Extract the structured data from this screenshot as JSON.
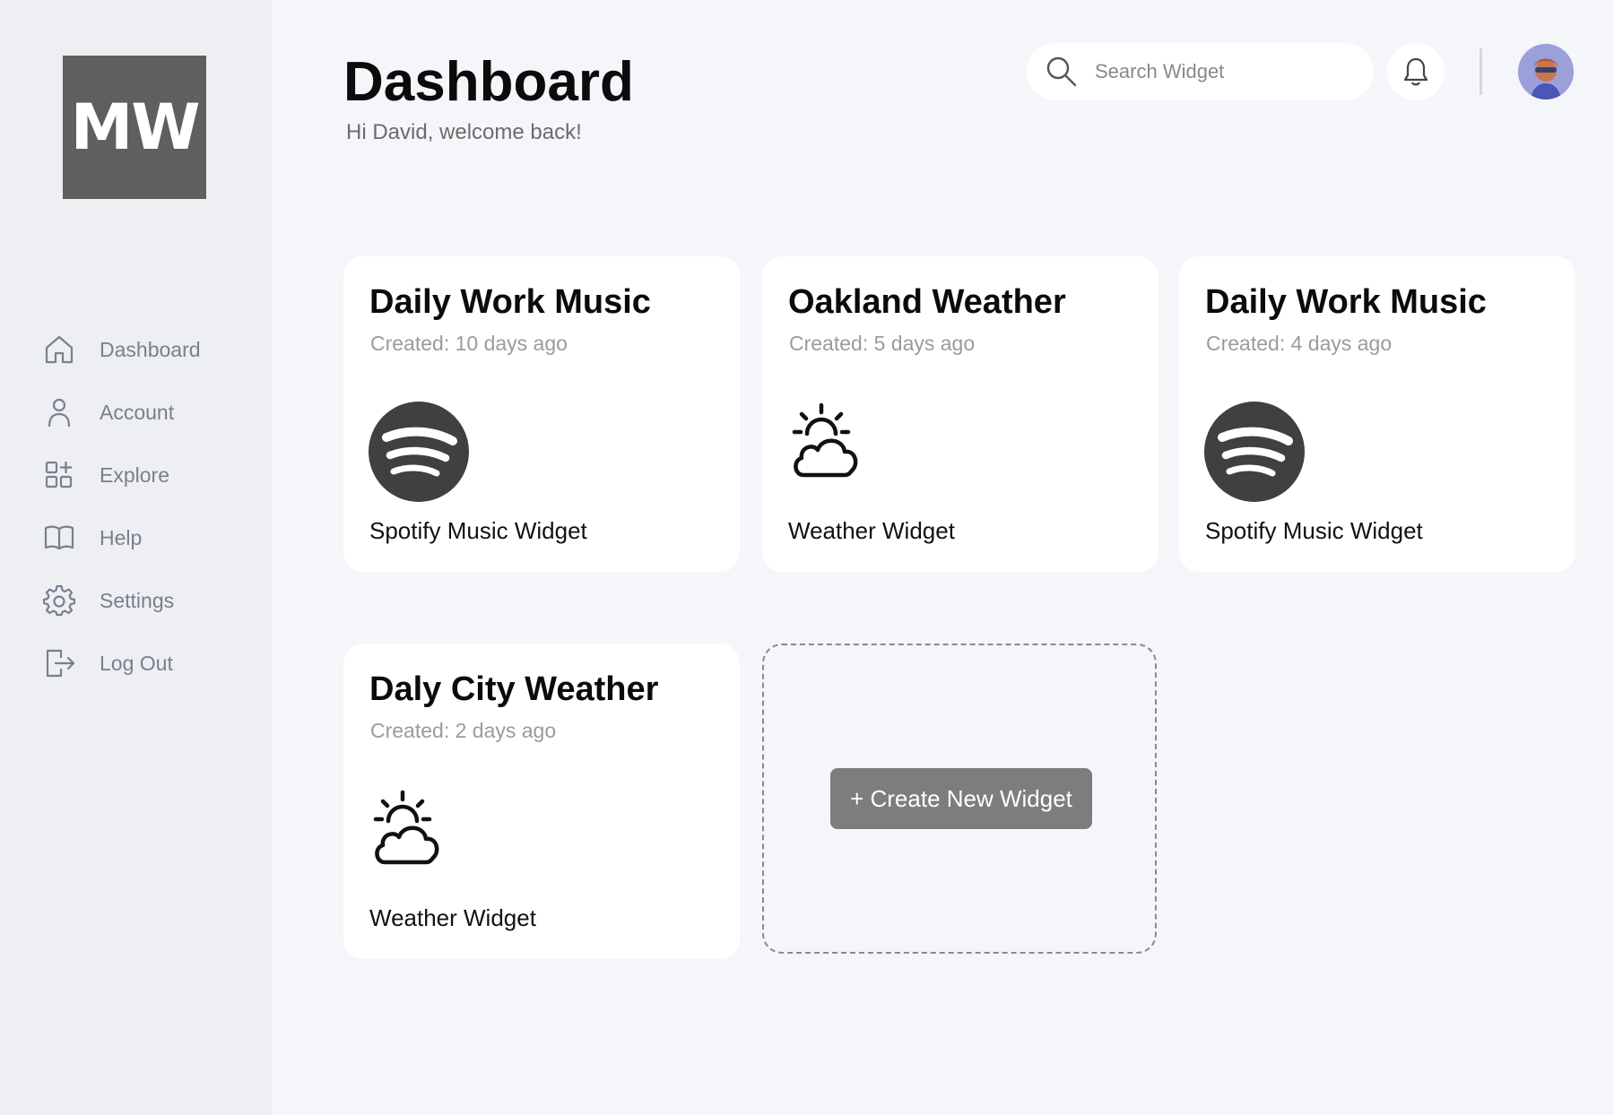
{
  "logo": {
    "text": "MW"
  },
  "nav": {
    "items": [
      {
        "label": "Dashboard"
      },
      {
        "label": "Account"
      },
      {
        "label": "Explore"
      },
      {
        "label": "Help"
      },
      {
        "label": "Settings"
      },
      {
        "label": "Log Out"
      }
    ]
  },
  "header": {
    "title": "Dashboard",
    "subtitle": "Hi David, welcome back!"
  },
  "search": {
    "placeholder": "Search Widget",
    "value": ""
  },
  "cards": [
    {
      "title": "Daily Work Music",
      "created": "Created: 10 days ago",
      "label": "Spotify Music Widget",
      "icon": "spotify-icon"
    },
    {
      "title": "Oakland Weather",
      "created": "Created: 5 days ago",
      "label": "Weather Widget",
      "icon": "weather-icon"
    },
    {
      "title": "Daily Work Music",
      "created": "Created: 4 days ago",
      "label": "Spotify Music Widget",
      "icon": "spotify-icon"
    },
    {
      "title": "Daly City Weather",
      "created": "Created: 2 days ago",
      "label": "Weather Widget",
      "icon": "weather-icon"
    }
  ],
  "create_button": {
    "label": "+ Create New Widget"
  },
  "colors": {
    "background": "#f5f6fa",
    "sidebar": "#eeeff3",
    "logo_bg": "#5f5f5f",
    "spotify_circle": "#3f4042",
    "create_button": "#7d7d7d"
  }
}
